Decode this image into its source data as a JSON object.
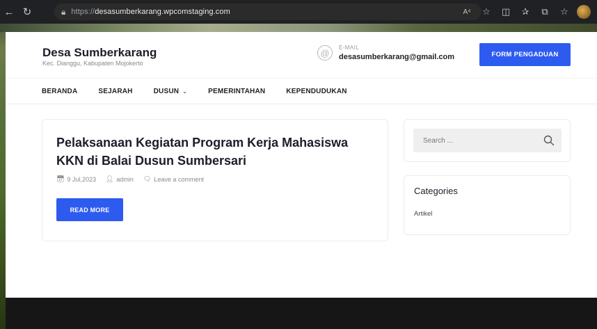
{
  "browser": {
    "url_protocol": "https://",
    "url_host": "desasumberkarang.wpcomstaging.com",
    "back_icon": "arrow-left",
    "refresh_icon": "refresh",
    "lock_icon": "lock",
    "read_aloud_label": "A⁴",
    "favorite_icon": "star",
    "split_icon": "split-screen",
    "favorites_icon": "favorites",
    "collections_icon": "collections",
    "extensions_icon": "extensions"
  },
  "site": {
    "title": "Desa Sumberkarang",
    "subtitle": "Kec. Dianggu, Kabupaten Mojokerto",
    "email_label": "E-MAIL",
    "email_value": "desasumberkarang@gmail.com",
    "form_button": "FORM PENGADUAN"
  },
  "menu": {
    "items": [
      "BERANDA",
      "SEJARAH",
      "DUSUN",
      "PEMERINTAHAN",
      "KEPENDUDUKAN"
    ]
  },
  "post": {
    "title": "Pelaksanaan Kegiatan Program Kerja Mahasiswa KKN di Balai Dusun Sumbersari",
    "date": "9 Jul,2023",
    "author": "admin",
    "comment": "Leave a comment",
    "read_more": "READ MORE"
  },
  "sidebar": {
    "search_placeholder": "Search ...",
    "categories_title": "Categories",
    "categories": [
      "Artikel"
    ]
  },
  "colors": {
    "accent": "#2e5bef",
    "footer": "#161616"
  }
}
